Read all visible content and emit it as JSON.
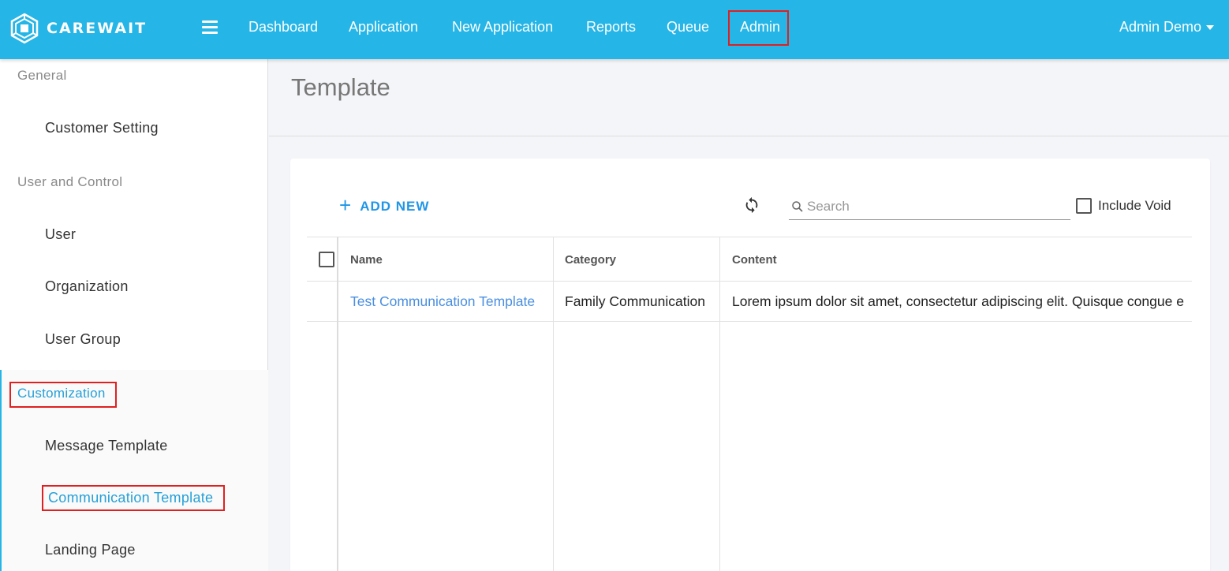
{
  "app": {
    "brand": "CAREWAIT",
    "user": "Admin Demo"
  },
  "nav": {
    "items": [
      "Dashboard",
      "Application",
      "New Application",
      "Reports",
      "Queue",
      "Admin"
    ],
    "active": "Admin"
  },
  "sidebar": {
    "sections": [
      {
        "title": "General",
        "items": [
          "Customer Setting"
        ]
      },
      {
        "title": "User and Control",
        "items": [
          "User",
          "Organization",
          "User Group"
        ]
      },
      {
        "title": "Customization",
        "items": [
          "Message Template",
          "Communication Template",
          "Landing Page"
        ]
      }
    ],
    "active_item": "Communication Template"
  },
  "page": {
    "title": "Template"
  },
  "toolbar": {
    "add_new_label": "ADD NEW",
    "search_placeholder": "Search",
    "include_void_label": "Include Void",
    "include_void_checked": false
  },
  "table": {
    "columns": [
      "Name",
      "Category",
      "Content"
    ],
    "rows": [
      {
        "name": "Test Communication Template",
        "category": "Family Communication",
        "content": "Lorem ipsum dolor sit amet, consectetur adipiscing elit. Quisque congue e"
      }
    ]
  },
  "colors": {
    "topbar": "#25b5e6",
    "accent": "#2196e6",
    "link": "#4a8fe0",
    "highlight_box": "#e02020"
  },
  "icons": [
    "menu-icon",
    "refresh-icon",
    "search-icon",
    "plus-icon",
    "caret-down-icon",
    "carewait-logo-icon"
  ]
}
